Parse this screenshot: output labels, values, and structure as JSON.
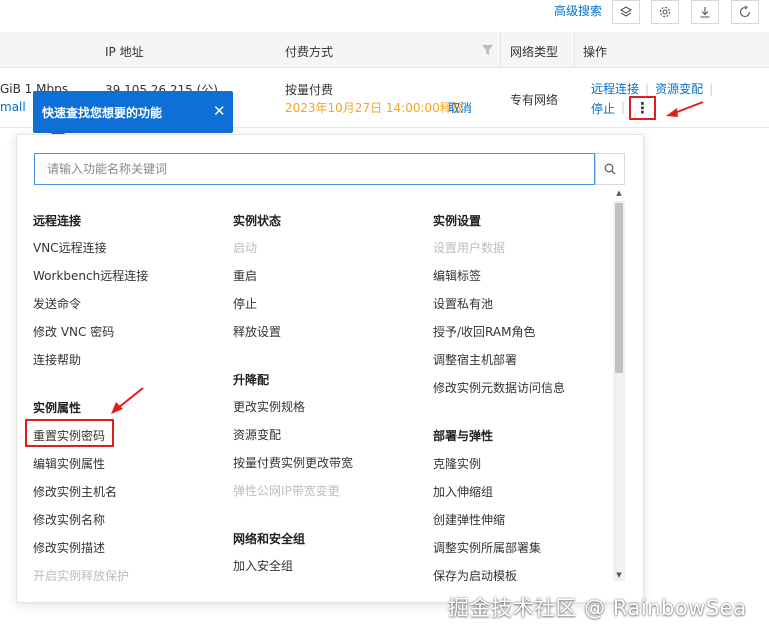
{
  "toolbar": {
    "advanced_search": "高级搜索",
    "icons": [
      "layers-icon",
      "gear-icon",
      "download-icon",
      "refresh-icon"
    ]
  },
  "table": {
    "headers": {
      "ip": "IP 地址",
      "billing": "付费方式",
      "network": "网络类型",
      "actions": "操作"
    },
    "row": {
      "bandwidth": "GiB 1 Mbps",
      "spec_suffix": "mall",
      "ip": "39.105.26.215 (公)",
      "billing": "按量付费",
      "release_time": "2023年10月27日 14:00:00释放",
      "cancel": "取消",
      "network": "专有网络",
      "action_remote": "远程连接",
      "action_change": "资源变配",
      "action_stop": "停止",
      "more_glyph": "⋮"
    }
  },
  "tooltip": {
    "text": "快速查找您想要的功能",
    "close": "✕"
  },
  "panel": {
    "search_placeholder": "请输入功能名称关键词",
    "col1": {
      "h1": "远程连接",
      "i1": "VNC远程连接",
      "i2": "Workbench远程连接",
      "i3": "发送命令",
      "i4": "修改 VNC 密码",
      "i5": "连接帮助",
      "h2": "实例属性",
      "i6": "重置实例密码",
      "i7": "编辑实例属性",
      "i8": "修改实例主机名",
      "i9": "修改实例名称",
      "i10": "修改实例描述",
      "i11": "开启实例释放保护"
    },
    "col2": {
      "h1": "实例状态",
      "i1": "启动",
      "i2": "重启",
      "i3": "停止",
      "i4": "释放设置",
      "h2": "升降配",
      "i5": "更改实例规格",
      "i6": "资源变配",
      "i7": "按量付费实例更改带宽",
      "i8": "弹性公网IP带宽变更",
      "h3": "网络和安全组",
      "i9": "加入安全组"
    },
    "col3": {
      "h1": "实例设置",
      "i1": "设置用户数据",
      "i2": "编辑标签",
      "i3": "设置私有池",
      "i4": "授予/收回RAM角色",
      "i5": "调整宿主机部署",
      "i6": "修改实例元数据访问信息",
      "h2": "部署与弹性",
      "i7": "克隆实例",
      "i8": "加入伸缩组",
      "i9": "创建弹性伸缩",
      "i10": "调整实例所属部署集",
      "i11": "保存为启动模板"
    }
  },
  "watermark": "掘金技术社区 @ RainbowSea",
  "colors": {
    "link": "#0070cc",
    "tooltip_bg": "#0e6fd6",
    "highlight_red": "#e21d1d",
    "release_orange": "#f5a623",
    "disabled": "#bdbdbd"
  }
}
